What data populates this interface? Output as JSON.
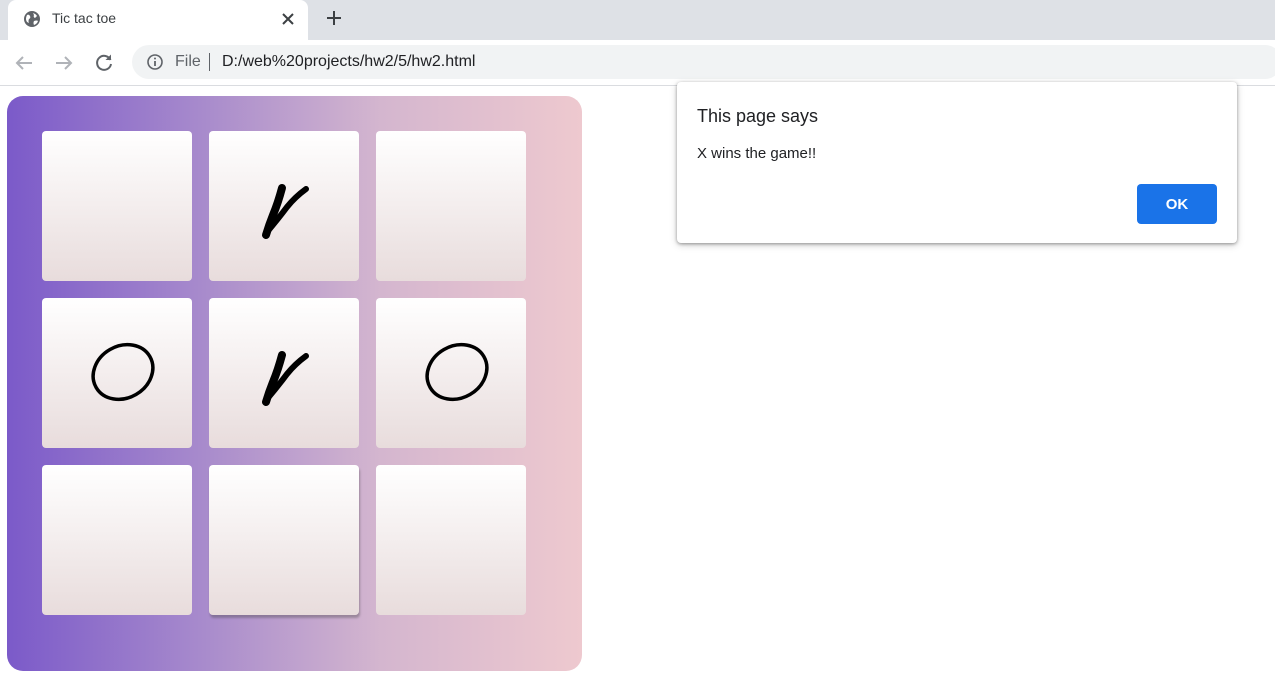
{
  "browser": {
    "tab_title": "Tic tac toe",
    "omnibox_scheme_label": "File",
    "url": "D:/web%20projects/hw2/5/hw2.html"
  },
  "game": {
    "board": [
      [
        "",
        "X",
        ""
      ],
      [
        "O",
        "X",
        "O"
      ],
      [
        "",
        "",
        ""
      ]
    ],
    "colors": {
      "gradient_start": "#7b5ac9",
      "gradient_end": "#eec9cf",
      "mark": "#000000"
    }
  },
  "dialog": {
    "heading": "This page says",
    "message": "X wins the game!!",
    "ok_label": "OK",
    "ok_color": "#1a73e8"
  },
  "icons": [
    "globe-icon",
    "close-icon",
    "plus-icon",
    "back-arrow-icon",
    "forward-arrow-icon",
    "reload-icon",
    "info-icon",
    "x-mark-icon",
    "o-mark-icon"
  ]
}
